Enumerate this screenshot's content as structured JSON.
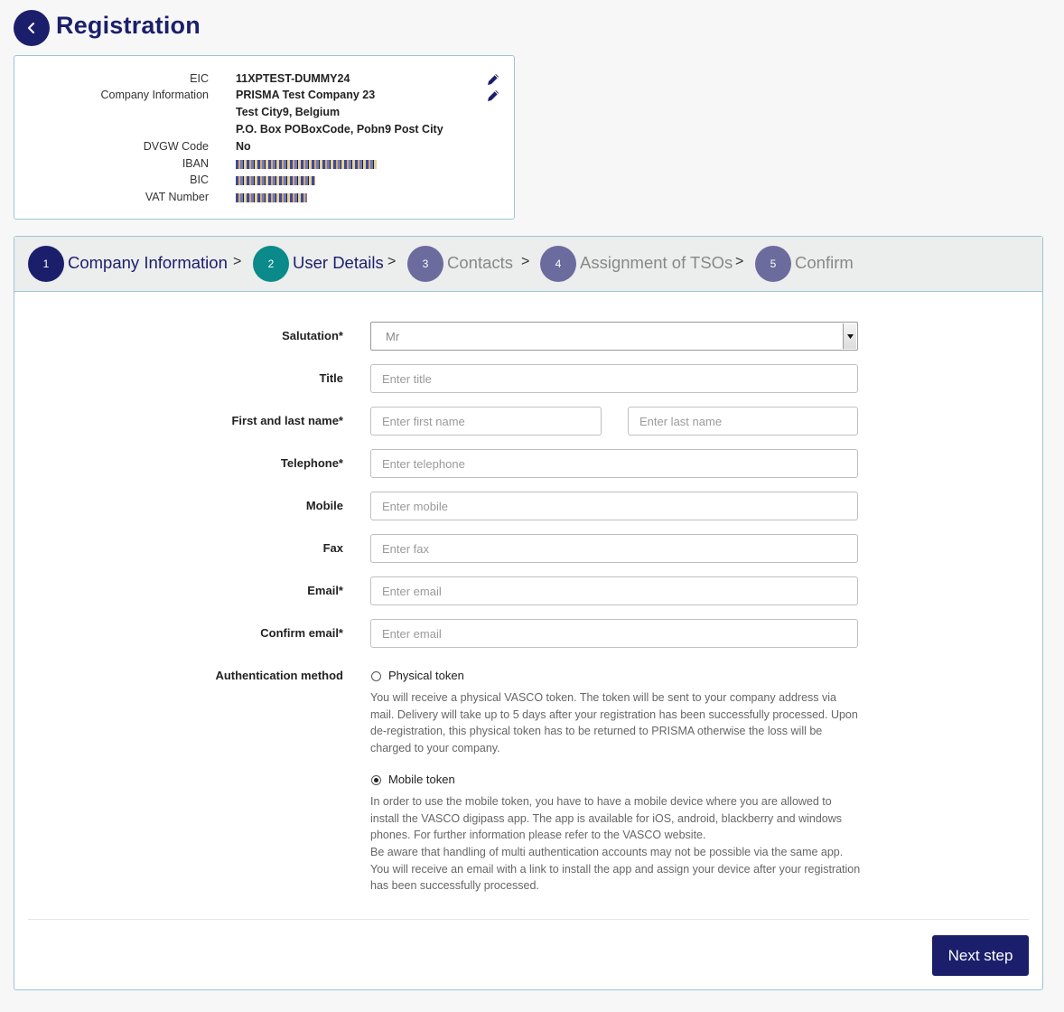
{
  "header": {
    "title": "Registration"
  },
  "summary": {
    "rows": [
      {
        "label": "EIC",
        "value": "11XPTEST-DUMMY24"
      },
      {
        "label": "Company Information",
        "value": "PRISMA Test Company 23"
      },
      {
        "label": "",
        "value": "Test City9, Belgium"
      },
      {
        "label": "",
        "value": "P.O. Box POBoxCode, Pobn9 Post City"
      },
      {
        "label": "DVGW Code",
        "value": "No"
      },
      {
        "label": "IBAN",
        "value": ""
      },
      {
        "label": "BIC",
        "value": ""
      },
      {
        "label": "VAT Number",
        "value": ""
      }
    ]
  },
  "steps": [
    {
      "number": "1",
      "label": "Company Information",
      "state": "done",
      "color": "#1b1f6b"
    },
    {
      "number": "2",
      "label": "User Details",
      "state": "active",
      "color": "#0a8a8a"
    },
    {
      "number": "3",
      "label": "Contacts",
      "state": "pending",
      "color": "#6b6b9e"
    },
    {
      "number": "4",
      "label": "Assignment of TSOs",
      "state": "pending",
      "color": "#6b6b9e"
    },
    {
      "number": "5",
      "label": "Confirm",
      "state": "pending",
      "color": "#6b6b9e"
    }
  ],
  "step_separator": ">",
  "form": {
    "salutation": {
      "label": "Salutation*",
      "value": "Mr"
    },
    "title": {
      "label": "Title",
      "placeholder": "Enter title"
    },
    "name": {
      "label": "First and last name*",
      "first_placeholder": "Enter first name",
      "last_placeholder": "Enter last name"
    },
    "telephone": {
      "label": "Telephone*",
      "placeholder": "Enter telephone"
    },
    "mobile": {
      "label": "Mobile",
      "placeholder": "Enter mobile"
    },
    "fax": {
      "label": "Fax",
      "placeholder": "Enter fax"
    },
    "email": {
      "label": "Email*",
      "placeholder": "Enter email"
    },
    "confirm_email": {
      "label": "Confirm email*",
      "placeholder": "Enter email"
    },
    "auth": {
      "label": "Authentication method",
      "options": [
        {
          "label": "Physical token",
          "checked": false,
          "help": "You will receive a physical VASCO token. The token will be sent to your company address via mail. Delivery will take up to 5 days after your registration has been successfully processed. Upon de-registration, this physical token has to be returned to PRISMA otherwise the loss will be charged to your company."
        },
        {
          "label": "Mobile token",
          "checked": true,
          "help1": "In order to use the mobile token, you have to have a mobile device where you are allowed to install the VASCO digipass app. The app is available for iOS, android, blackberry and windows phones. For further information please refer to the VASCO website.",
          "help2": "Be aware that handling of multi authentication accounts may not be possible via the same app. You will receive an email with a link to install the app and assign your device after your registration has been successfully processed."
        }
      ]
    }
  },
  "footer": {
    "next_label": "Next step"
  },
  "colors": {
    "primary": "#1b1f6b",
    "active_step": "#0a8a8a",
    "pending_step": "#6b6b9e",
    "border": "#9cc6d4"
  }
}
